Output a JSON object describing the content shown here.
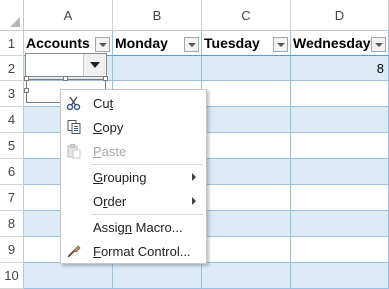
{
  "columns": [
    "A",
    "B",
    "C",
    "D"
  ],
  "rows": [
    "1",
    "2",
    "3",
    "4",
    "5",
    "6",
    "7",
    "8",
    "9",
    "10"
  ],
  "table": {
    "headers": [
      "Accounts",
      "Monday",
      "Tuesday",
      "Wednesday"
    ],
    "d2_value": "8"
  },
  "menu": {
    "items": [
      {
        "label": "Cut",
        "hotkey": "t",
        "icon": "scissors-icon",
        "enabled": true
      },
      {
        "label": "Copy",
        "hotkey": "C",
        "icon": "copy-icon",
        "enabled": true
      },
      {
        "label": "Paste",
        "hotkey": "P",
        "icon": "paste-icon",
        "enabled": false
      },
      {
        "label": "Grouping",
        "hotkey": "G",
        "submenu": true,
        "enabled": true
      },
      {
        "label": "Order",
        "hotkey": "r",
        "submenu": true,
        "enabled": true
      },
      {
        "label": "Assign Macro...",
        "hotkey": "n",
        "enabled": true
      },
      {
        "label": "Format Control...",
        "hotkey": "F",
        "icon": "format-control-icon",
        "enabled": true
      }
    ]
  },
  "colors": {
    "band": "#ddebf7",
    "border": "#9bc2e6",
    "header_underline": "#5b9bd5"
  }
}
